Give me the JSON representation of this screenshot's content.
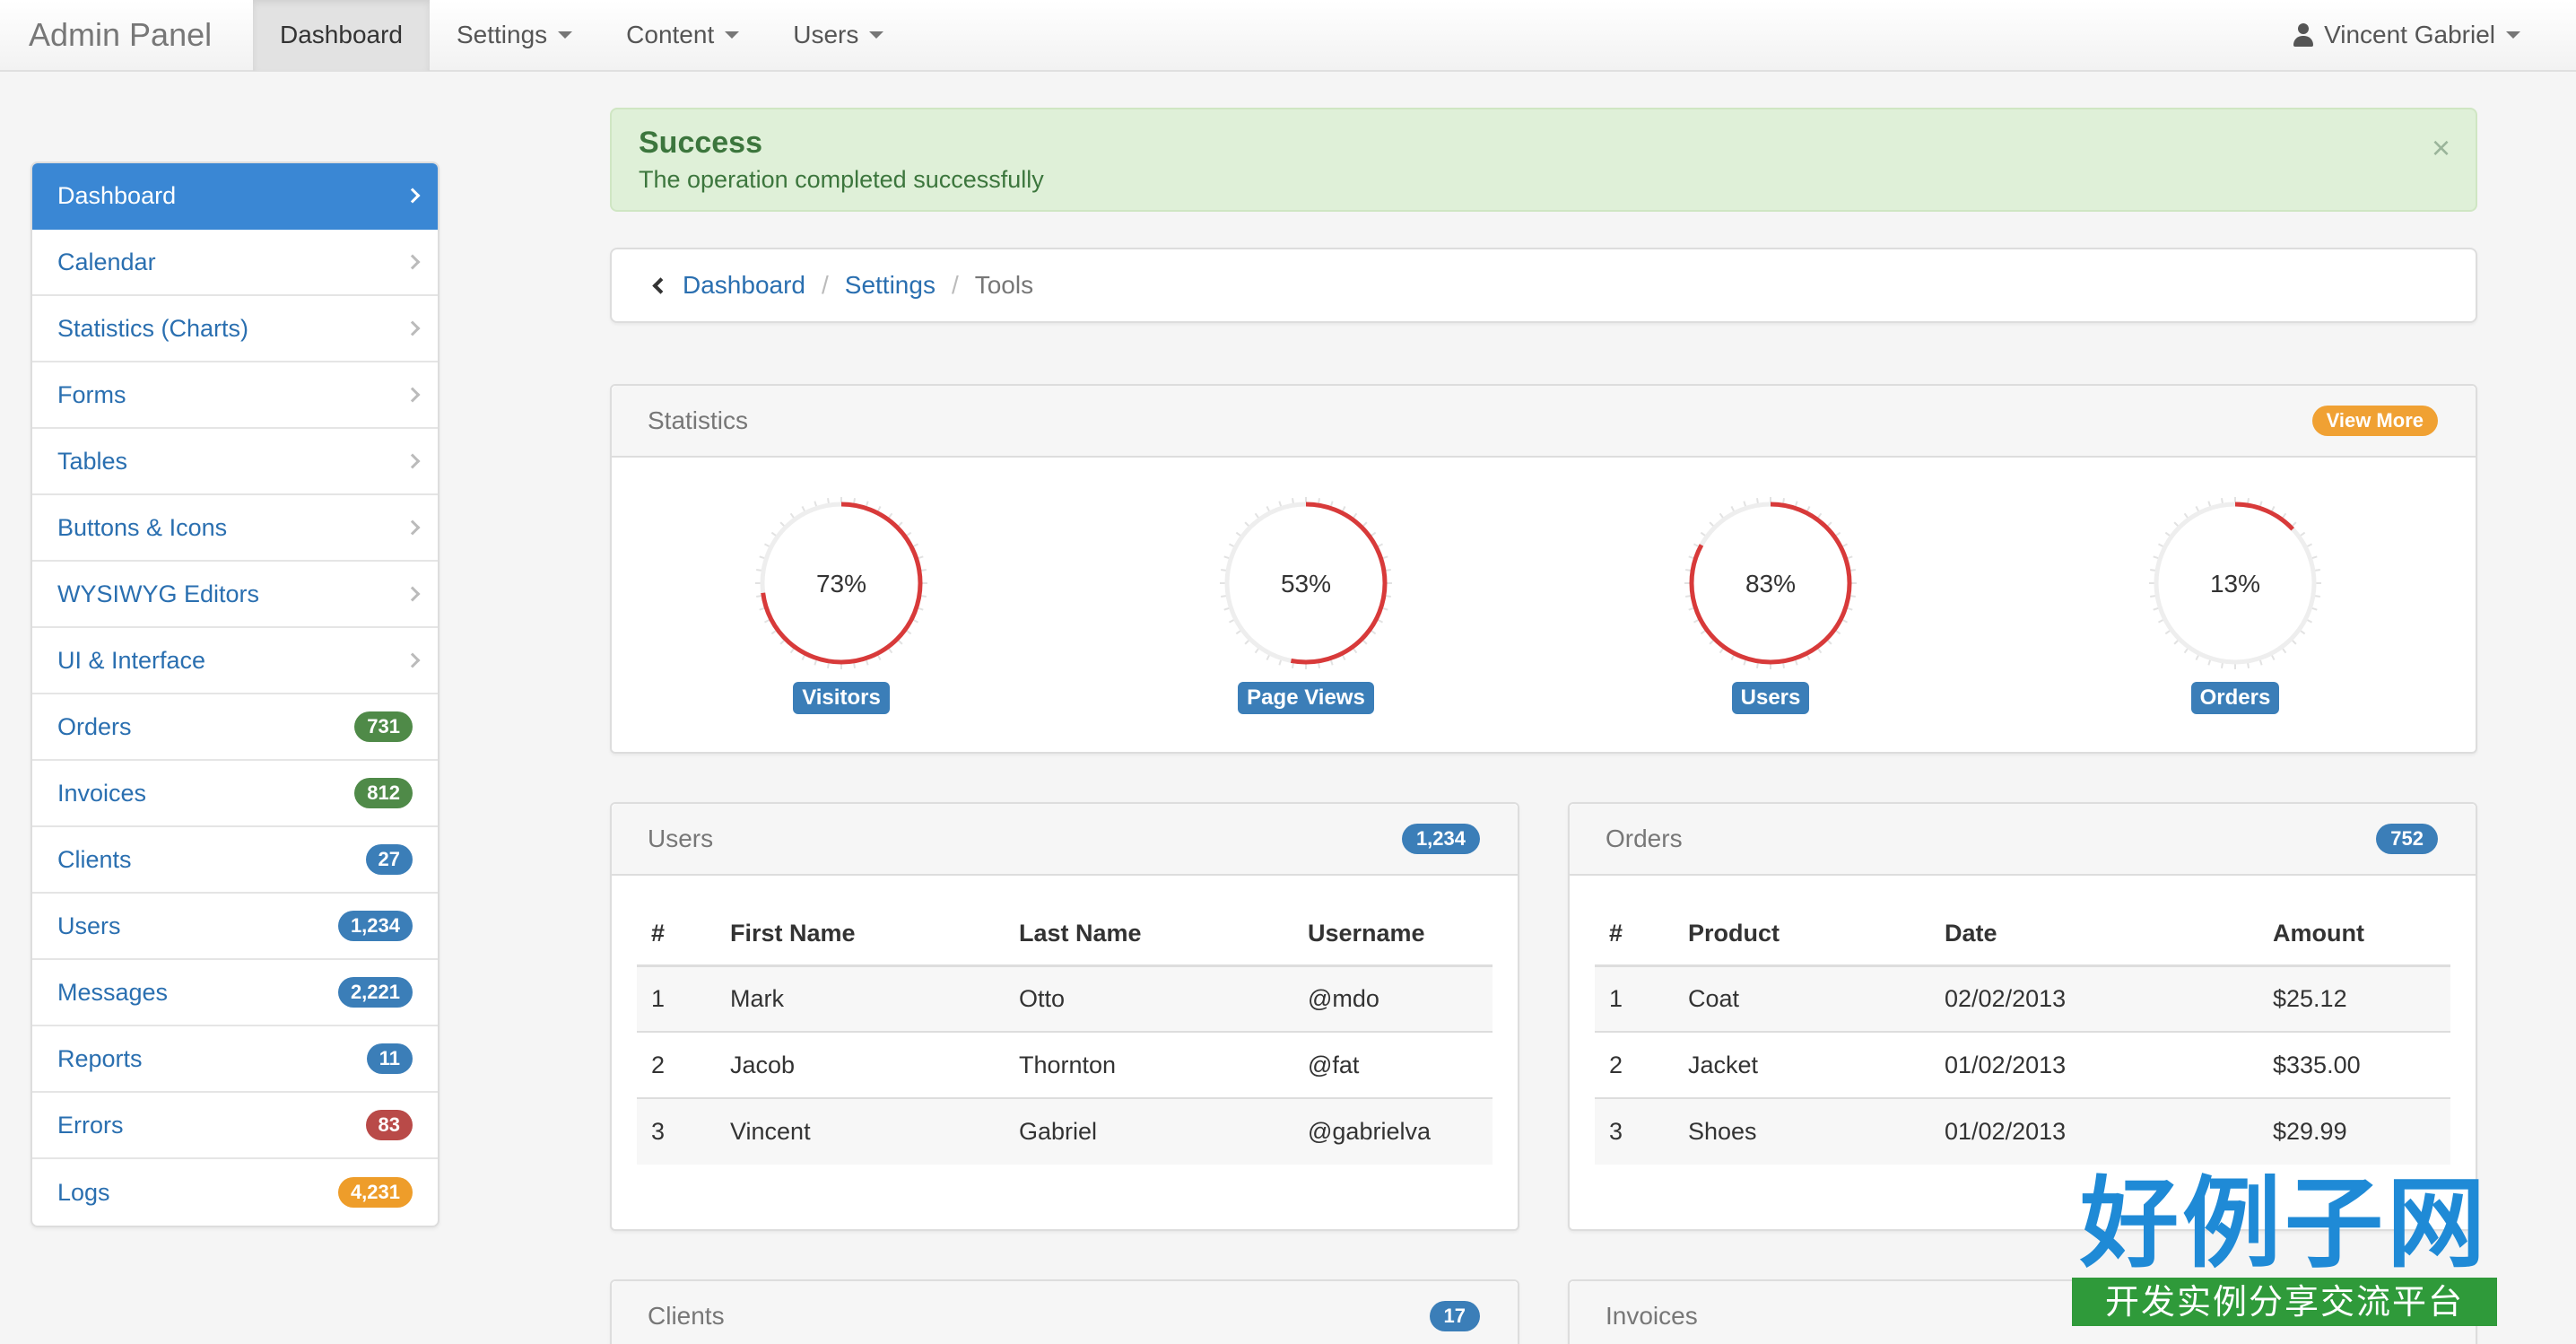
{
  "navbar": {
    "brand": "Admin Panel",
    "items": [
      {
        "label": "Dashboard",
        "active": true,
        "dropdown": false
      },
      {
        "label": "Settings",
        "active": false,
        "dropdown": true
      },
      {
        "label": "Content",
        "active": false,
        "dropdown": true
      },
      {
        "label": "Users",
        "active": false,
        "dropdown": true
      }
    ],
    "user": "Vincent Gabriel"
  },
  "sidebar": {
    "items": [
      {
        "label": "Dashboard",
        "active": true
      },
      {
        "label": "Calendar"
      },
      {
        "label": "Statistics (Charts)"
      },
      {
        "label": "Forms"
      },
      {
        "label": "Tables"
      },
      {
        "label": "Buttons & Icons"
      },
      {
        "label": "WYSIWYG Editors"
      },
      {
        "label": "UI & Interface"
      },
      {
        "label": "Orders",
        "badge": "731",
        "badge_color": "#4f8a48"
      },
      {
        "label": "Invoices",
        "badge": "812",
        "badge_color": "#4f8a48"
      },
      {
        "label": "Clients",
        "badge": "27",
        "badge_color": "#3b7eb8"
      },
      {
        "label": "Users",
        "badge": "1,234",
        "badge_color": "#3b7eb8"
      },
      {
        "label": "Messages",
        "badge": "2,221",
        "badge_color": "#3b7eb8"
      },
      {
        "label": "Reports",
        "badge": "11",
        "badge_color": "#3b7eb8"
      },
      {
        "label": "Errors",
        "badge": "83",
        "badge_color": "#b94a48"
      },
      {
        "label": "Logs",
        "badge": "4,231",
        "badge_color": "#ee9d2a"
      }
    ]
  },
  "alert": {
    "title": "Success",
    "text": "The operation completed successfully",
    "close": "×"
  },
  "breadcrumb": {
    "items": [
      "Dashboard",
      "Settings"
    ],
    "current": "Tools",
    "separator": "/"
  },
  "stats": {
    "title": "Statistics",
    "button": "View More",
    "button_color": "#f0a133",
    "gauge_color": "#d83a3a",
    "items": [
      {
        "percent": 73,
        "text": "73%",
        "label": "Visitors"
      },
      {
        "percent": 53,
        "text": "53%",
        "label": "Page Views"
      },
      {
        "percent": 83,
        "text": "83%",
        "label": "Users"
      },
      {
        "percent": 13,
        "text": "13%",
        "label": "Orders"
      }
    ]
  },
  "users_panel": {
    "title": "Users",
    "badge": "1,234",
    "columns": [
      "#",
      "First Name",
      "Last Name",
      "Username"
    ],
    "rows": [
      [
        "1",
        "Mark",
        "Otto",
        "@mdo"
      ],
      [
        "2",
        "Jacob",
        "Thornton",
        "@fat"
      ],
      [
        "3",
        "Vincent",
        "Gabriel",
        "@gabrielva"
      ]
    ]
  },
  "orders_panel": {
    "title": "Orders",
    "badge": "752",
    "columns": [
      "#",
      "Product",
      "Date",
      "Amount"
    ],
    "rows": [
      [
        "1",
        "Coat",
        "02/02/2013",
        "$25.12"
      ],
      [
        "2",
        "Jacket",
        "01/02/2013",
        "$335.00"
      ],
      [
        "3",
        "Shoes",
        "01/02/2013",
        "$29.99"
      ]
    ]
  },
  "clients_panel": {
    "title": "Clients",
    "badge": "17"
  },
  "invoices_panel": {
    "title": "Invoices"
  },
  "watermark": {
    "big": "好例子网",
    "small": "开发实例分享交流平台"
  }
}
